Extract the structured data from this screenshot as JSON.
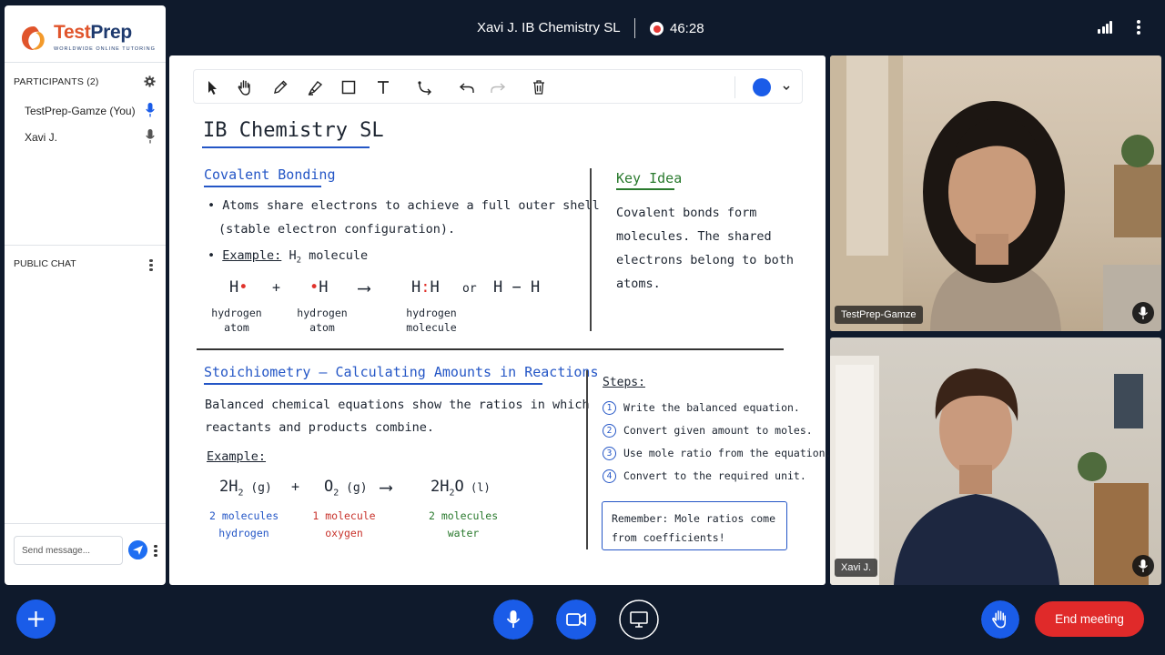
{
  "header": {
    "meeting_title": "Xavi J. IB Chemistry SL",
    "timer": "46:28"
  },
  "brand": {
    "name_part1": "Test",
    "name_part2": "Prep",
    "tagline": "WORLDWIDE ONLINE TUTORING"
  },
  "sidebar": {
    "participants_header": "PARTICIPANTS (2)",
    "participants": [
      {
        "name": "TestPrep-Gamze (You)",
        "mic": "active"
      },
      {
        "name": "Xavi J.",
        "mic": "idle"
      }
    ],
    "chat_header": "PUBLIC CHAT",
    "message_placeholder": "Send message..."
  },
  "toolbar": {
    "tools": [
      "select",
      "pan",
      "pencil",
      "highlighter",
      "rectangle",
      "text",
      "connector",
      "undo",
      "redo",
      "delete"
    ],
    "current_color": "#1a5ce8"
  },
  "board": {
    "title": "IB Chemistry SL",
    "covalent": {
      "heading": "Covalent Bonding",
      "bullet1_line1": "Atoms share electrons to achieve a full outer shell",
      "bullet1_line2": "(stable electron configuration).",
      "example_label": "Example:",
      "example_text": "H",
      "example_sub": "2",
      "example_tail": " molecule",
      "atom1": "H",
      "plus": "+",
      "atom2": "H",
      "arrow": "⟶",
      "molecule_left": "H",
      "molecule_right": "H",
      "or": "or",
      "bond_line": "H − H",
      "label_atom1_l1": "hydrogen",
      "label_atom1_l2": "atom",
      "label_atom2_l1": "hydrogen",
      "label_atom2_l2": "atom",
      "label_mol_l1": "hydrogen",
      "label_mol_l2": "molecule"
    },
    "key_idea": {
      "heading": "Key Idea",
      "line1": "Covalent bonds form",
      "line2": "molecules. The shared",
      "line3": "electrons belong to both",
      "line4": "atoms."
    },
    "stoich": {
      "heading": "Stoichiometry — Calculating Amounts in Reactions",
      "line1": "Balanced chemical equations show the ratios in which",
      "line2": "reactants and products combine.",
      "example_label": "Example:",
      "term1_coef": "2H",
      "term1_sub": "2",
      "term1_state": " (g)",
      "plus": "+",
      "term2": "O",
      "term2_sub": "2",
      "term2_state": " (g)",
      "arrow": "⟶",
      "term3_a": "2H",
      "term3_sub": "2",
      "term3_b": "O",
      "term3_state": " (l)",
      "note1_l1": "2 molecules",
      "note1_l2": "hydrogen",
      "note2_l1": "1 molecule",
      "note2_l2": "oxygen",
      "note3_l1": "2 molecules",
      "note3_l2": "water"
    },
    "steps": {
      "heading": "Steps:",
      "items": [
        {
          "n": "1",
          "text": "Write the balanced equation."
        },
        {
          "n": "2",
          "text": "Convert given amount to moles."
        },
        {
          "n": "3",
          "text": "Use mole ratio from the equation."
        },
        {
          "n": "4",
          "text": "Convert to the required unit."
        }
      ],
      "remember_l1": "Remember: Mole ratios come",
      "remember_l2": "from coefficients!"
    }
  },
  "videos": [
    {
      "name": "TestPrep-Gamze"
    },
    {
      "name": "Xavi J."
    }
  ],
  "controls": {
    "end_label": "End meeting"
  },
  "colors": {
    "accent_blue": "#1a5ce8",
    "end_red": "#e02a2a",
    "background": "#0f1a2c",
    "ink_blue": "#2456c6",
    "ink_red": "#c8322b",
    "ink_green": "#2a7a2e"
  }
}
